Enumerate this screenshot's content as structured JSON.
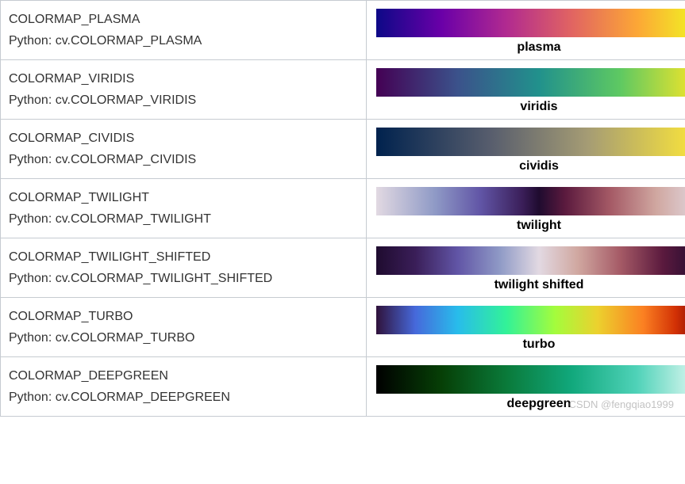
{
  "watermark": "CSDN @fengqiao1999",
  "rows": [
    {
      "name": "COLORMAP_PLASMA",
      "python": "Python: cv.COLORMAP_PLASMA",
      "caption": "plasma",
      "swatch_class": "g-plasma"
    },
    {
      "name": "COLORMAP_VIRIDIS",
      "python": "Python: cv.COLORMAP_VIRIDIS",
      "caption": "viridis",
      "swatch_class": "g-viridis"
    },
    {
      "name": "COLORMAP_CIVIDIS",
      "python": "Python: cv.COLORMAP_CIVIDIS",
      "caption": "cividis",
      "swatch_class": "g-cividis"
    },
    {
      "name": "COLORMAP_TWILIGHT",
      "python": "Python: cv.COLORMAP_TWILIGHT",
      "caption": "twilight",
      "swatch_class": "g-twilight"
    },
    {
      "name": "COLORMAP_TWILIGHT_SHIFTED",
      "python": "Python: cv.COLORMAP_TWILIGHT_SHIFTED",
      "caption": "twilight shifted",
      "swatch_class": "g-twilight-shifted"
    },
    {
      "name": "COLORMAP_TURBO",
      "python": "Python: cv.COLORMAP_TURBO",
      "caption": "turbo",
      "swatch_class": "g-turbo"
    },
    {
      "name": "COLORMAP_DEEPGREEN",
      "python": "Python: cv.COLORMAP_DEEPGREEN",
      "caption": "deepgreen",
      "swatch_class": "g-deepgreen"
    }
  ]
}
